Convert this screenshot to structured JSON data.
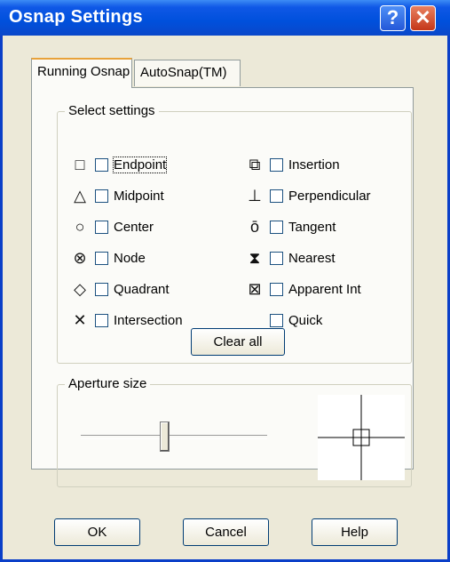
{
  "window": {
    "title": "Osnap Settings",
    "help_glyph": "?",
    "close_glyph": "✕"
  },
  "tabs": [
    {
      "label": "Running Osnap",
      "active": true
    },
    {
      "label": "AutoSnap(TM)",
      "active": false
    }
  ],
  "select_settings": {
    "label": "Select settings",
    "left": [
      {
        "icon": "endpoint-icon",
        "glyph": "□",
        "label": "Endpoint",
        "checked": false
      },
      {
        "icon": "midpoint-icon",
        "glyph": "△",
        "label": "Midpoint",
        "checked": false
      },
      {
        "icon": "center-icon",
        "glyph": "○",
        "label": "Center",
        "checked": false
      },
      {
        "icon": "node-icon",
        "glyph": "⊗",
        "label": "Node",
        "checked": false
      },
      {
        "icon": "quadrant-icon",
        "glyph": "◇",
        "label": "Quadrant",
        "checked": false
      },
      {
        "icon": "intersection-icon",
        "glyph": "✕",
        "label": "Intersection",
        "checked": false
      }
    ],
    "right": [
      {
        "icon": "insertion-icon",
        "glyph": "⧉",
        "label": "Insertion",
        "checked": false
      },
      {
        "icon": "perpendicular-icon",
        "glyph": "⊥",
        "label": "Perpendicular",
        "checked": false
      },
      {
        "icon": "tangent-icon",
        "glyph": "ō",
        "label": "Tangent",
        "checked": false
      },
      {
        "icon": "nearest-icon",
        "glyph": "⧗",
        "label": "Nearest",
        "checked": false
      },
      {
        "icon": "apparent-int-icon",
        "glyph": "⊠",
        "label": "Apparent Int",
        "checked": false
      },
      {
        "icon": "",
        "glyph": "",
        "label": "Quick",
        "checked": false
      }
    ],
    "clear_all": "Clear all"
  },
  "aperture": {
    "label": "Aperture size",
    "level": 0.45
  },
  "buttons": {
    "ok": "OK",
    "cancel": "Cancel",
    "help": "Help"
  }
}
